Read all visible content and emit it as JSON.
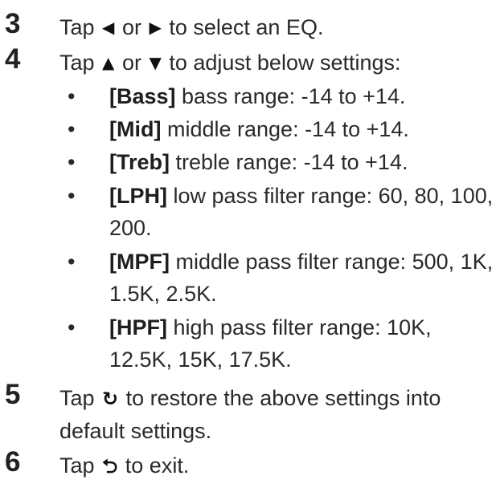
{
  "steps": [
    {
      "number": "3",
      "before": "Tap ",
      "icon_a": "◀",
      "icon_a_name": "left-triangle-icon",
      "middle": " or ",
      "icon_b": "▶",
      "icon_b_name": "right-triangle-icon",
      "after": " to select an EQ."
    },
    {
      "number": "4",
      "before": "Tap ",
      "icon_a": "▲",
      "icon_a_name": "up-triangle-icon",
      "middle": " or ",
      "icon_b": "▼",
      "icon_b_name": "down-triangle-icon",
      "after": " to adjust below settings:"
    },
    {
      "number": "5",
      "before": "Tap ",
      "icon": "↻",
      "icon_name": "restore-icon",
      "after": " to restore the above settings into default settings."
    },
    {
      "number": "6",
      "before": "Tap ",
      "icon": "⮌",
      "icon_name": "back-arrow-icon",
      "after": " to exit."
    }
  ],
  "settings": [
    {
      "bullet": "•",
      "key": "[Bass]",
      "text": " bass range: -14 to +14."
    },
    {
      "bullet": "•",
      "key": "[Mid]",
      "text": " middle range: -14 to +14."
    },
    {
      "bullet": "•",
      "key": "[Treb]",
      "text": " treble range: -14 to +14."
    },
    {
      "bullet": "•",
      "key": "[LPH]",
      "text": " low pass filter range: 60, 80, 100, 200."
    },
    {
      "bullet": "•",
      "key": "[MPF]",
      "text": " middle pass filter range: 500, 1K, 1.5K, 2.5K."
    },
    {
      "bullet": "•",
      "key": "[HPF]",
      "text": " high pass filter range: 10K, 12.5K, 15K, 17.5K."
    }
  ]
}
